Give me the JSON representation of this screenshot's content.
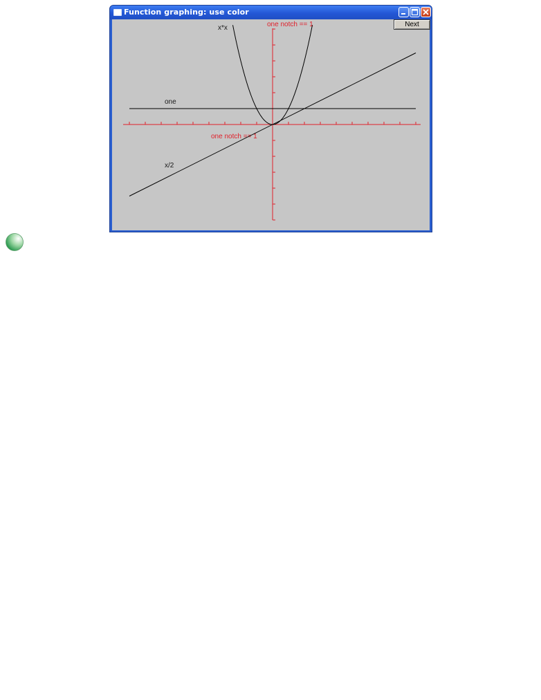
{
  "window": {
    "title": "Function graphing: use color"
  },
  "toolbar": {
    "next_label": "Next"
  },
  "graph": {
    "y_axis_label": "one notch == 1",
    "x_axis_label": "one notch == 1",
    "axis_color": "#e0202a",
    "function_color": "#000000",
    "background_color": "#c6c6c6"
  },
  "chart_data": {
    "type": "line",
    "xlim": [
      -10,
      10
    ],
    "ylim": [
      -6,
      6
    ],
    "series": [
      {
        "name": "one",
        "function": "1",
        "x": [
          -9,
          9
        ],
        "y": [
          1,
          1
        ]
      },
      {
        "name": "x/2",
        "function": "x/2",
        "x": [
          -9,
          9
        ],
        "y": [
          -4.5,
          4.5
        ]
      },
      {
        "name": "x*x",
        "function": "x*x",
        "x": [
          -2.5,
          -2,
          -1,
          0,
          1,
          2,
          2.5
        ],
        "y": [
          6.25,
          4,
          1,
          0,
          1,
          4,
          6.25
        ]
      }
    ]
  }
}
